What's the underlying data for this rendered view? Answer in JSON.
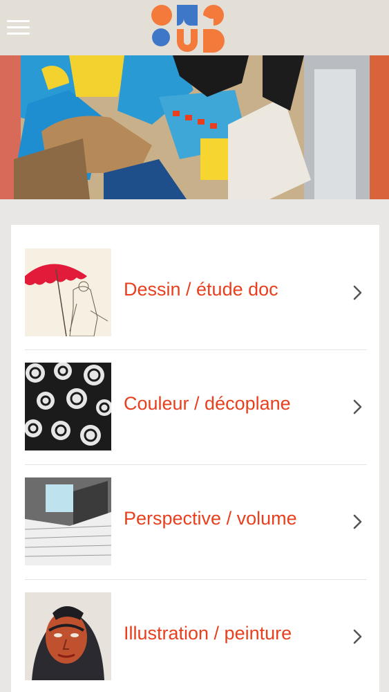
{
  "header": {
    "menu_icon": "hamburger-menu-icon",
    "logo_alt": "ANE SUD",
    "colors": {
      "bar": "#e4dfd6",
      "logo_orange": "#f47a3c",
      "logo_blue": "#3f77c8"
    }
  },
  "banner": {
    "description_icon": "collage-artwork-image"
  },
  "menu": {
    "accent_color": "#e8401e",
    "items": [
      {
        "label": "Dessin / étude doc",
        "icon": "chevron-right-icon",
        "thumb": "red-umbrella-drawing"
      },
      {
        "label": "Couleur / décoplane",
        "icon": "chevron-right-icon",
        "thumb": "black-white-pattern"
      },
      {
        "label": "Perspective / volume",
        "icon": "chevron-right-icon",
        "thumb": "architectural-perspective"
      },
      {
        "label": "Illustration / peinture",
        "icon": "chevron-right-icon",
        "thumb": "painted-portrait"
      }
    ]
  }
}
